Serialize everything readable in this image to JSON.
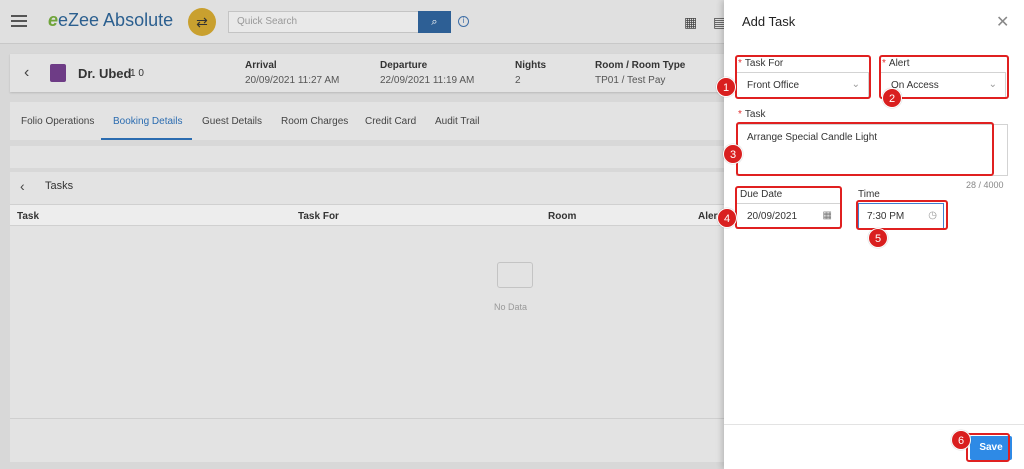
{
  "app": {
    "logo_text": "eZee Absolute",
    "search_placeholder": "Quick Search"
  },
  "guest": {
    "name": "Dr. Ubed",
    "pax": "1  0",
    "arrival_label": "Arrival",
    "arrival_value": "20/09/2021 11:27 AM",
    "departure_label": "Departure",
    "departure_value": "22/09/2021 11:19 AM",
    "nights_label": "Nights",
    "nights_value": "2",
    "room_label": "Room / Room Type",
    "room_value": "TP01 / Test Pay"
  },
  "tabs": [
    {
      "label": "Folio Operations"
    },
    {
      "label": "Booking Details"
    },
    {
      "label": "Guest Details"
    },
    {
      "label": "Room Charges"
    },
    {
      "label": "Credit Card"
    },
    {
      "label": "Audit Trail"
    }
  ],
  "tasks": {
    "title": "Tasks",
    "columns": [
      "Task",
      "Task For",
      "Room",
      "Alert"
    ],
    "empty_text": "No Data"
  },
  "drawer": {
    "title": "Add Task",
    "task_for_label": "Task For",
    "task_for_value": "Front Office",
    "alert_label": "Alert",
    "alert_value": "On Access",
    "task_label": "Task",
    "task_value": "Arrange Special Candle Light",
    "task_counter": "28 / 4000",
    "due_date_label": "Due Date",
    "due_date_value": "20/09/2021",
    "time_label": "Time",
    "time_value": "7:30 PM",
    "save_label": "Save"
  },
  "annotations": [
    "1",
    "2",
    "3",
    "4",
    "5",
    "6"
  ],
  "colors": {
    "accent": "#2e8ae6",
    "annotation": "#e02020",
    "brand_blue": "#2b5f8f",
    "brand_green": "#6fa43a"
  }
}
